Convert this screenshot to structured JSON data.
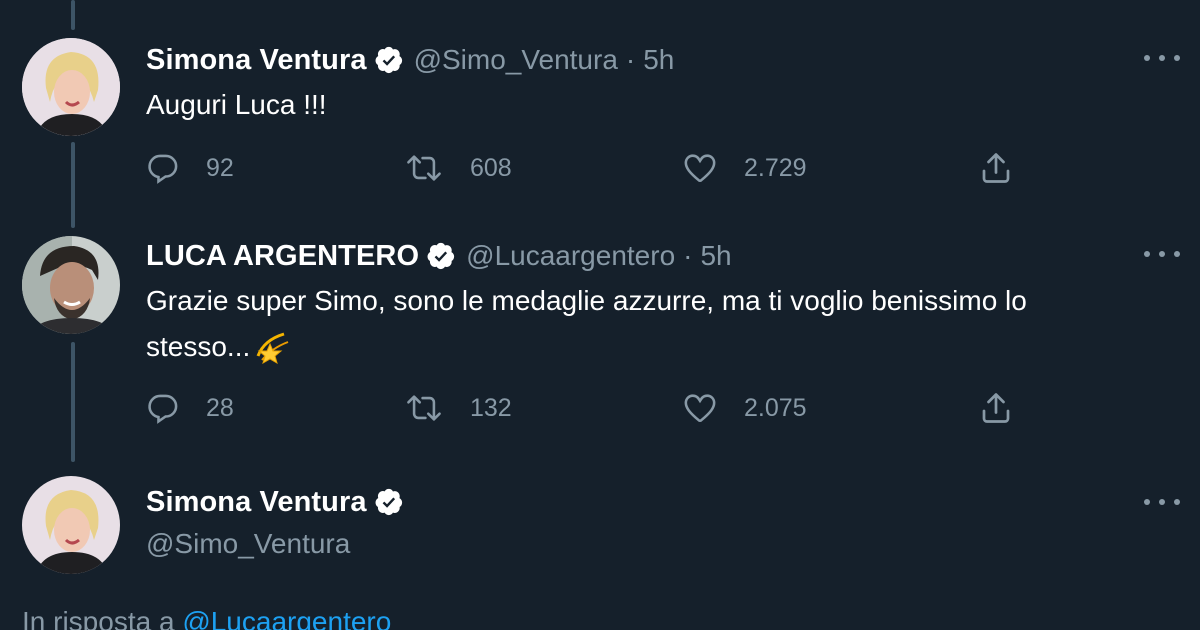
{
  "colors": {
    "background": "#15202b",
    "secondary_text": "#8899a6",
    "link": "#1da1f2",
    "verified_badge": "#ffffff",
    "thread_line": "#3d5466"
  },
  "tweets": [
    {
      "name": "Simona Ventura",
      "handle": "@Simo_Ventura",
      "separator": "·",
      "time": "5h",
      "text": "Auguri Luca !!!",
      "replies": "92",
      "retweets": "608",
      "likes": "2.729",
      "icons": [
        "reply-icon",
        "retweet-icon",
        "like-icon",
        "share-icon",
        "more-icon",
        "verified-icon"
      ]
    },
    {
      "name": "LUCA ARGENTERO",
      "handle": "@Lucaargentero",
      "separator": "·",
      "time": "5h",
      "text_line1": "Grazie super Simo, sono le medaglie azzurre, ma ti voglio benissimo lo",
      "text_line2": "stesso...",
      "emoji": "dizzy-star-emoji",
      "replies": "28",
      "retweets": "132",
      "likes": "2.075"
    },
    {
      "name": "Simona Ventura",
      "handle": "@Simo_Ventura"
    }
  ],
  "reply_context": {
    "prefix": "In risposta a",
    "mention": "@Lucaargentero"
  }
}
